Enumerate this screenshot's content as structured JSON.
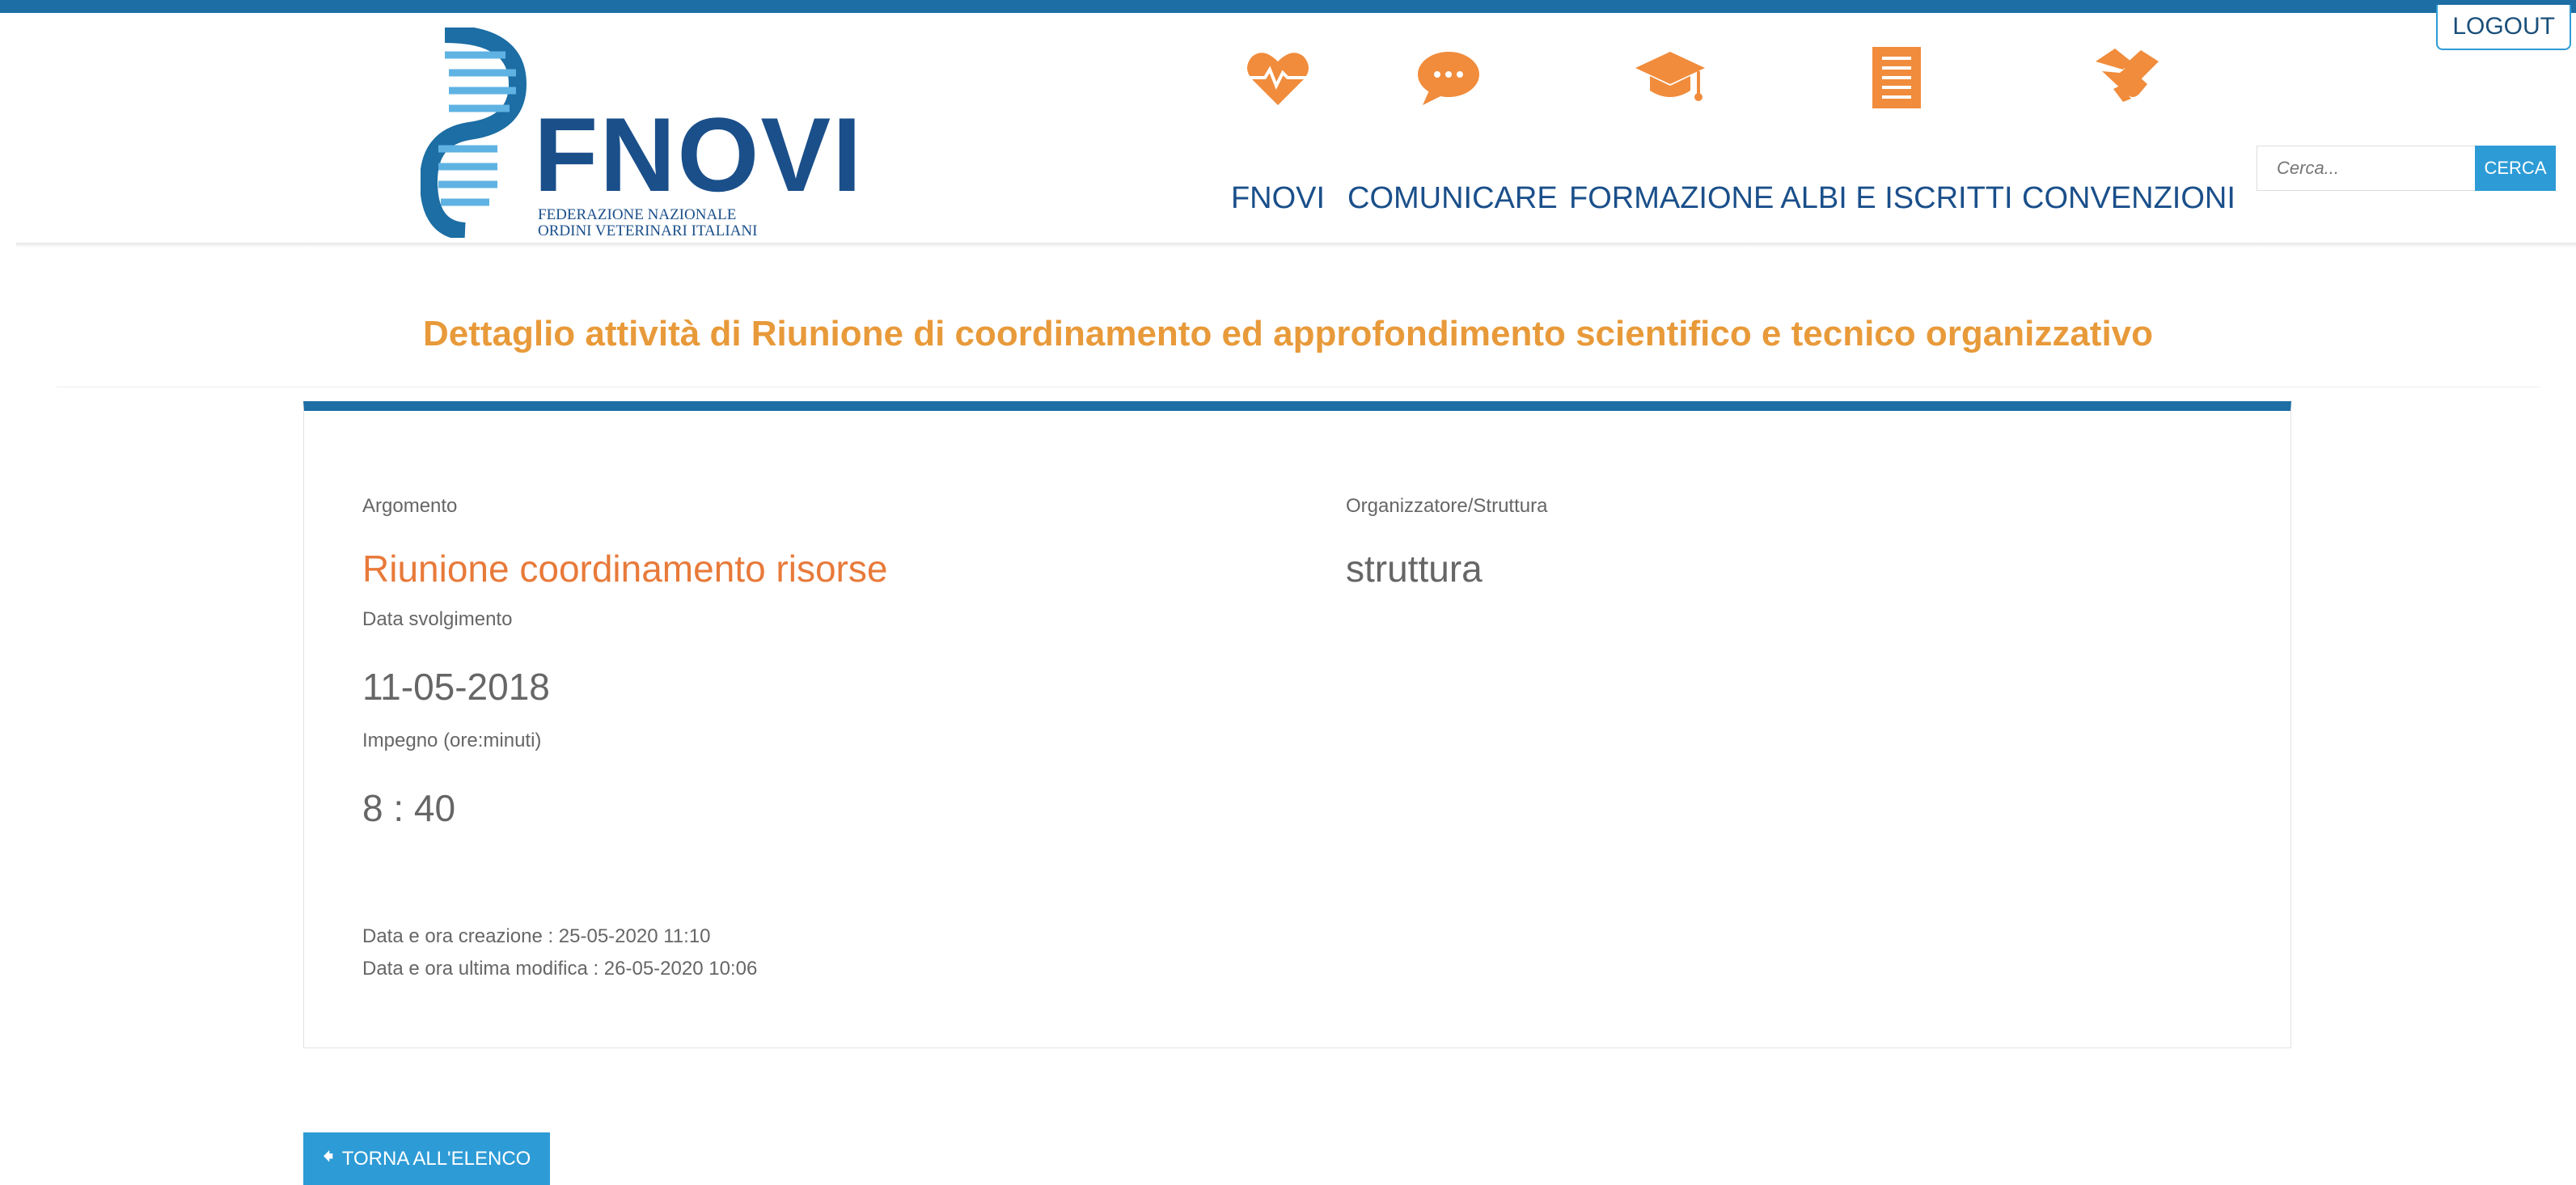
{
  "header": {
    "logout_label": "LOGOUT",
    "logo": {
      "name": "FNOVI",
      "subtitle_line1": "FEDERAZIONE NAZIONALE",
      "subtitle_line2": "ORDINI VETERINARI ITALIANI"
    },
    "nav": [
      {
        "label": "FNOVI",
        "icon": "heart-pulse-icon"
      },
      {
        "label": "COMUNICARE",
        "icon": "chat-bubble-icon"
      },
      {
        "label": "FORMAZIONE",
        "icon": "graduation-cap-icon"
      },
      {
        "label": "ALBI E ISCRITTI",
        "icon": "document-list-icon"
      },
      {
        "label": "CONVENZIONI",
        "icon": "handshake-icon"
      }
    ],
    "search": {
      "placeholder": "Cerca...",
      "button_label": "CERCA"
    }
  },
  "page": {
    "title": "Dettaglio attività di Riunione di coordinamento ed approfondimento scientifico e tecnico organizzativo"
  },
  "detail": {
    "argomento_label": "Argomento",
    "argomento_value": "Riunione coordinamento risorse",
    "organizzatore_label": "Organizzatore/Struttura",
    "organizzatore_value": "struttura",
    "data_label": "Data svolgimento",
    "data_value": "11-05-2018",
    "impegno_label": "Impegno (ore:minuti)",
    "impegno_value": "8 : 40",
    "creazione": "Data e ora creazione : 25-05-2020 11:10",
    "modifica": "Data e ora ultima modifica : 26-05-2020 10:06"
  },
  "actions": {
    "back_label": "TORNA ALL'ELENCO"
  },
  "colors": {
    "primary": "#1c6ea4",
    "button": "#2d9bd6",
    "accent": "#e89a3a",
    "icon": "#f08c3c"
  }
}
